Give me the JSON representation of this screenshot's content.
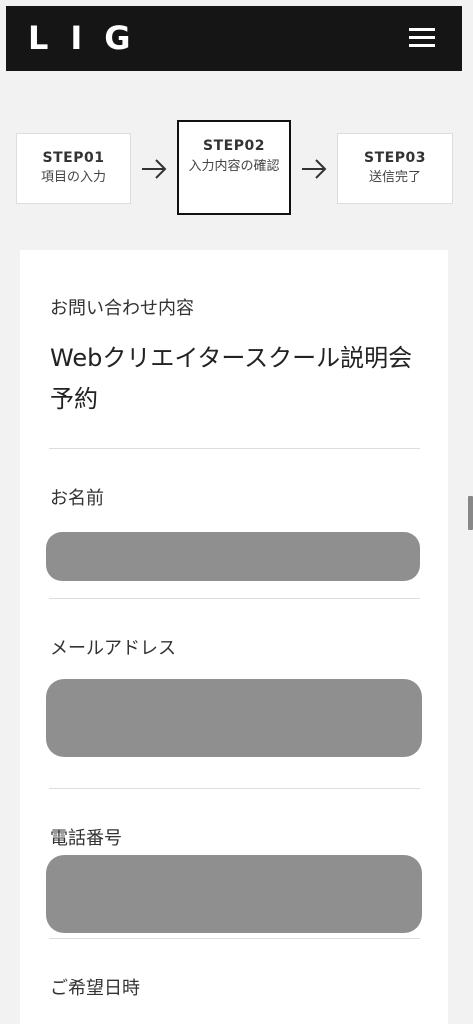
{
  "header": {
    "logo": "LIG",
    "menu_icon": "hamburger-menu-icon"
  },
  "steps": [
    {
      "num": "STEP01",
      "label": "項目の入力",
      "state": "done"
    },
    {
      "num": "STEP02",
      "label": "入力内容の確認",
      "state": "current"
    },
    {
      "num": "STEP03",
      "label": "送信完了",
      "state": "upcoming"
    }
  ],
  "form": {
    "inquiry": {
      "label": "お問い合わせ内容",
      "value": "Webクリエイタースクール説明会予約"
    },
    "name": {
      "label": "お名前"
    },
    "email": {
      "label": "メールアドレス"
    },
    "phone": {
      "label": "電話番号"
    },
    "datetime": {
      "label": "ご希望日時"
    }
  },
  "colors": {
    "header_bg": "#151515",
    "page_bg": "#f2f2f2",
    "redaction": "#8f8f8f"
  }
}
